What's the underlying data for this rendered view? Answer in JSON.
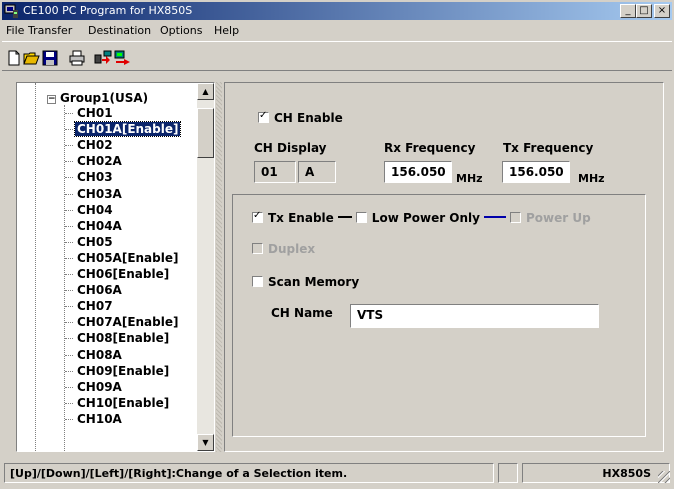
{
  "window": {
    "title": "CE100  PC Program for HX850S",
    "min_label": "_",
    "max_label": "□",
    "close_label": "×"
  },
  "menu": [
    "File",
    "Transfer",
    "Destination",
    "Options",
    "Help"
  ],
  "toolbar": {
    "icons": [
      "new-file-icon",
      "open-folder-icon",
      "save-icon",
      "print-icon",
      "read-from-radio-icon",
      "write-to-radio-icon"
    ]
  },
  "tree": {
    "root_label": "Group1(USA)",
    "expander": "−",
    "selected_index": 1,
    "items": [
      "CH01",
      "CH01A[Enable]",
      "CH02",
      "CH02A",
      "CH03",
      "CH03A",
      "CH04",
      "CH04A",
      "CH05",
      "CH05A[Enable]",
      "CH06[Enable]",
      "CH06A",
      "CH07",
      "CH07A[Enable]",
      "CH08[Enable]",
      "CH08A",
      "CH09[Enable]",
      "CH09A",
      "CH10[Enable]",
      "CH10A"
    ],
    "scroll_up": "▲",
    "scroll_down": "▼"
  },
  "channel": {
    "enable_label": "CH Enable",
    "enable_checked": true,
    "display_label": "CH Display",
    "display_number": "01",
    "display_suffix": "A",
    "rx_label": "Rx Frequency",
    "rx_value": "156.050",
    "tx_label": "Tx Frequency",
    "tx_value": "156.050",
    "unit": "MHz",
    "tx_enable_label": "Tx Enable",
    "tx_enable_checked": true,
    "low_power_label": "Low Power Only",
    "low_power_checked": false,
    "power_up_label": "Power Up",
    "power_up_checked": false,
    "duplex_label": "Duplex",
    "duplex_checked": false,
    "scan_memory_label": "Scan Memory",
    "scan_memory_checked": false,
    "name_label": "CH Name",
    "name_value": "VTS"
  },
  "status": {
    "hint": "[Up]/[Down]/[Left]/[Right]:Change of a Selection item.",
    "middle": "",
    "model": "HX850S"
  },
  "colors": {
    "titlebar": "#0a246a",
    "selection": "#0a246a",
    "face": "#d4d0c8"
  }
}
